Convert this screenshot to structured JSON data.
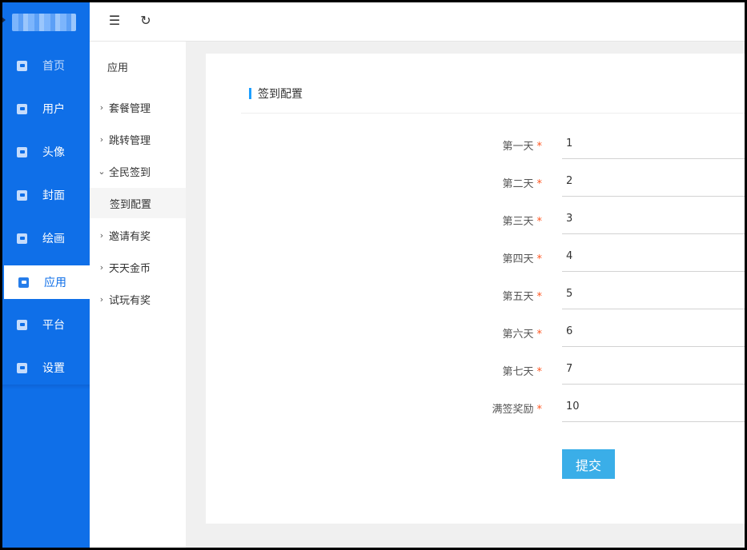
{
  "sidebar": {
    "items": [
      {
        "label": "首页",
        "icon": "store-icon",
        "state": "dim"
      },
      {
        "label": "用户",
        "icon": "diamond-icon",
        "state": ""
      },
      {
        "label": "头像",
        "icon": "user-card-icon",
        "state": ""
      },
      {
        "label": "封面",
        "icon": "star-frame-icon",
        "state": ""
      },
      {
        "label": "绘画",
        "icon": "picture-icon",
        "state": ""
      },
      {
        "label": "应用",
        "icon": "app-icon",
        "state": "active"
      },
      {
        "label": "平台",
        "icon": "platform-icon",
        "state": ""
      },
      {
        "label": "设置",
        "icon": "settings-icon",
        "state": ""
      }
    ]
  },
  "topbar": {
    "collapse_icon": "☰",
    "refresh_icon": "↻"
  },
  "subnav": {
    "title": "应用",
    "items": [
      {
        "label": "套餐管理",
        "chevron": "›",
        "type": "group"
      },
      {
        "label": "跳转管理",
        "chevron": "›",
        "type": "group"
      },
      {
        "label": "全民签到",
        "chevron": "⌄",
        "type": "group"
      },
      {
        "label": "签到配置",
        "chevron": "",
        "type": "child"
      },
      {
        "label": "邀请有奖",
        "chevron": "›",
        "type": "group"
      },
      {
        "label": "天天金币",
        "chevron": "›",
        "type": "group"
      },
      {
        "label": "试玩有奖",
        "chevron": "›",
        "type": "group"
      }
    ]
  },
  "main": {
    "section_title": "签到配置",
    "required_mark": "*",
    "fields": [
      {
        "label": "第一天",
        "value": "1"
      },
      {
        "label": "第二天",
        "value": "2"
      },
      {
        "label": "第三天",
        "value": "3"
      },
      {
        "label": "第四天",
        "value": "4"
      },
      {
        "label": "第五天",
        "value": "5"
      },
      {
        "label": "第六天",
        "value": "6"
      },
      {
        "label": "第七天",
        "value": "7"
      },
      {
        "label": "满签奖励",
        "value": "10"
      }
    ],
    "submit_label": "提交"
  },
  "colors": {
    "sidebar_bg": "#0f6fe8",
    "accent": "#1e9fff",
    "submit_bg": "#3aaee8",
    "required": "#ff5722"
  }
}
